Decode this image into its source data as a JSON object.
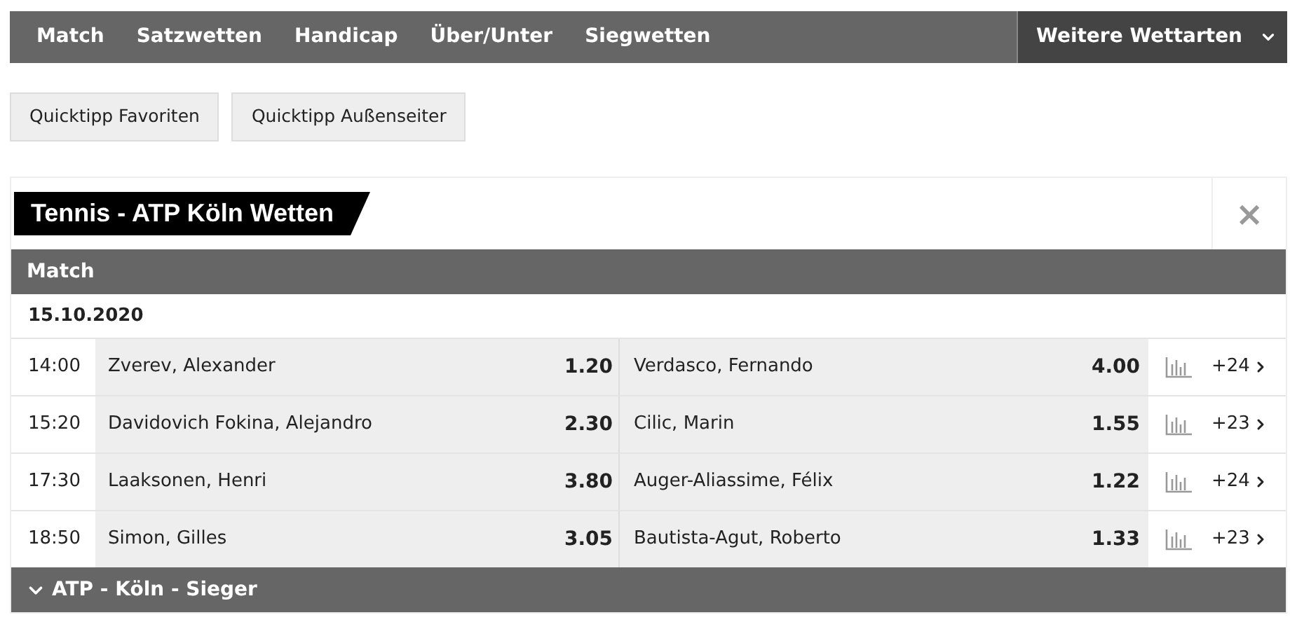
{
  "nav": {
    "tabs": [
      "Match",
      "Satzwetten",
      "Handicap",
      "Über/Unter",
      "Siegwetten"
    ],
    "more": "Weitere Wettarten"
  },
  "quicktips": [
    "Quicktipp Favoriten",
    "Quicktipp Außenseiter"
  ],
  "card": {
    "title": "Tennis - ATP Köln Wetten",
    "close": "×",
    "section": "Match",
    "date": "15.10.2020",
    "rows": [
      {
        "time": "14:00",
        "home": "Zverev, Alexander",
        "home_odds": "1.20",
        "away": "Verdasco, Fernando",
        "away_odds": "4.00",
        "more": "+24"
      },
      {
        "time": "15:20",
        "home": "Davidovich Fokina, Alejandro",
        "home_odds": "2.30",
        "away": "Cilic, Marin",
        "away_odds": "1.55",
        "more": "+23"
      },
      {
        "time": "17:30",
        "home": "Laaksonen, Henri",
        "home_odds": "3.80",
        "away": "Auger-Aliassime, Félix",
        "away_odds": "1.22",
        "more": "+24"
      },
      {
        "time": "18:50",
        "home": "Simon, Gilles",
        "home_odds": "3.05",
        "away": "Bautista-Agut, Roberto",
        "away_odds": "1.33",
        "more": "+23"
      }
    ],
    "footer": "ATP - Köln - Sieger"
  }
}
